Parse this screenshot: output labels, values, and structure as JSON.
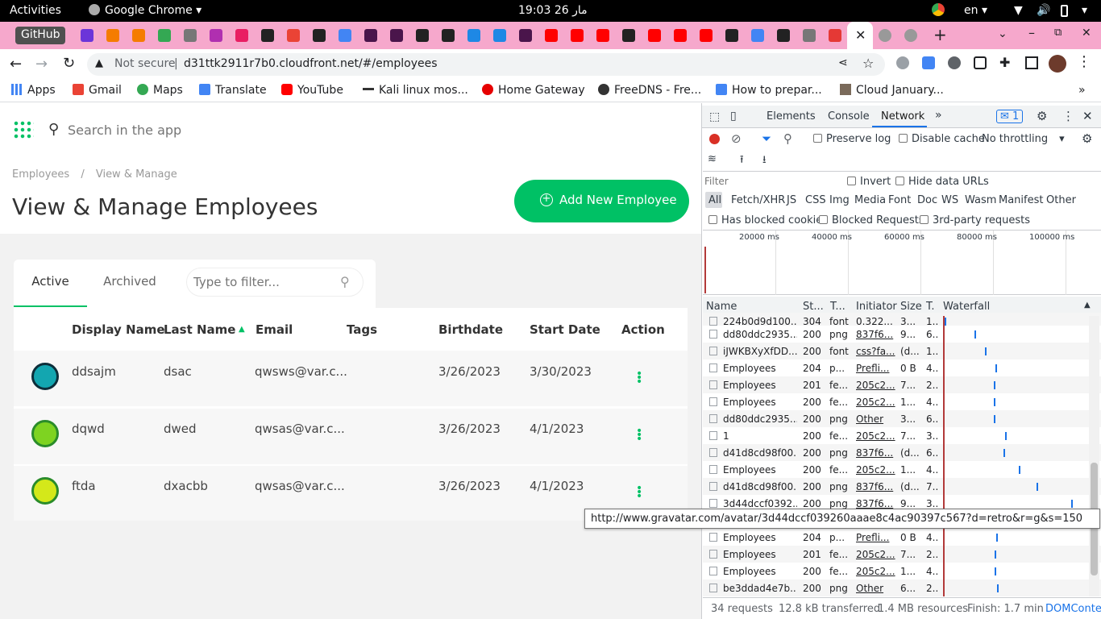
{
  "os": {
    "activities": "Activities",
    "app": "Google Chrome",
    "clock": "مار 26  19:03",
    "lang": "en"
  },
  "tabs": {
    "github": "GitHub"
  },
  "toolbar": {
    "not_secure": "Not secure",
    "url": "d31ttk2911r7b0.cloudfront.net/#/employees"
  },
  "bookmarks": [
    {
      "label": "Apps"
    },
    {
      "label": "Gmail"
    },
    {
      "label": "Maps"
    },
    {
      "label": "Translate"
    },
    {
      "label": "YouTube"
    },
    {
      "label": "Kali linux mos..."
    },
    {
      "label": "Home Gateway"
    },
    {
      "label": "FreeDNS - Fre..."
    },
    {
      "label": "How to prepar..."
    },
    {
      "label": "Cloud January..."
    }
  ],
  "app": {
    "search_placeholder": "Search in the app",
    "breadcrumb": {
      "root": "Employees",
      "sep": "/",
      "current": "View & Manage"
    },
    "title": "View & Manage Employees",
    "add_button": "Add New Employee",
    "tabs": {
      "active": "Active",
      "archived": "Archived"
    },
    "filter_placeholder": "Type to filter...",
    "columns": {
      "display_name": "Display Name",
      "last_name": "Last Name",
      "email": "Email",
      "tags": "Tags",
      "birthdate": "Birthdate",
      "start_date": "Start Date",
      "action": "Action"
    },
    "rows": [
      {
        "display_name": "ddsajm",
        "last_name": "dsac",
        "email": "qwsws@var.c...",
        "tags": "",
        "birthdate": "3/26/2023",
        "start_date": "3/30/2023"
      },
      {
        "display_name": "dqwd",
        "last_name": "dwed",
        "email": "qwsas@var.c...",
        "tags": "",
        "birthdate": "3/26/2023",
        "start_date": "4/1/2023"
      },
      {
        "display_name": "ftda",
        "last_name": "dxacbb",
        "email": "qwsas@var.c...",
        "tags": "",
        "birthdate": "3/26/2023",
        "start_date": "4/1/2023"
      }
    ]
  },
  "devtools": {
    "tabs": {
      "elements": "Elements",
      "console": "Console",
      "network": "Network",
      "issues": "1"
    },
    "preserve_log": "Preserve log",
    "disable_cache": "Disable cache",
    "throttling": "No throttling",
    "filter_placeholder": "Filter",
    "invert": "Invert",
    "hide_data_urls": "Hide data URLs",
    "types": [
      "All",
      "Fetch/XHR",
      "JS",
      "CSS",
      "Img",
      "Media",
      "Font",
      "Doc",
      "WS",
      "Wasm",
      "Manifest",
      "Other"
    ],
    "has_blocked_cookies": "Has blocked cookies",
    "blocked_requests": "Blocked Requests",
    "third_party": "3rd-party requests",
    "timeline_ticks": [
      "20000 ms",
      "40000 ms",
      "60000 ms",
      "80000 ms",
      "100000 ms"
    ],
    "columns": {
      "name": "Name",
      "status": "St...",
      "type": "T...",
      "initiator": "Initiator",
      "size": "Size",
      "time": "T.",
      "waterfall": "Waterfall"
    },
    "requests": [
      {
        "name": "224b0d9d100...",
        "status": "304",
        "type": "font",
        "initiator": "0.322...",
        "size": "3...",
        "time": "1..."
      },
      {
        "name": "dd80ddc2935...",
        "status": "200",
        "type": "png",
        "initiator": "837f6...",
        "size": "9...",
        "time": "6..."
      },
      {
        "name": "iJWKBXyXfDD...",
        "status": "200",
        "type": "font",
        "initiator": "css?fa...",
        "size": "(d...",
        "time": "1..."
      },
      {
        "name": "Employees",
        "status": "204",
        "type": "p...",
        "initiator": "Prefli...",
        "size": "0 B",
        "time": "4..."
      },
      {
        "name": "Employees",
        "status": "201",
        "type": "fe...",
        "initiator": "205c2...",
        "size": "7...",
        "time": "2..."
      },
      {
        "name": "Employees",
        "status": "200",
        "type": "fe...",
        "initiator": "205c2...",
        "size": "1...",
        "time": "4..."
      },
      {
        "name": "dd80ddc2935...",
        "status": "200",
        "type": "png",
        "initiator": "Other",
        "size": "3...",
        "time": "6..."
      },
      {
        "name": "1",
        "status": "200",
        "type": "fe...",
        "initiator": "205c2...",
        "size": "7...",
        "time": "3..."
      },
      {
        "name": "d41d8cd98f00...",
        "status": "200",
        "type": "png",
        "initiator": "837f6...",
        "size": "(d...",
        "time": "6..."
      },
      {
        "name": "Employees",
        "status": "200",
        "type": "fe...",
        "initiator": "205c2...",
        "size": "1...",
        "time": "4..."
      },
      {
        "name": "d41d8cd98f00...",
        "status": "200",
        "type": "png",
        "initiator": "837f6...",
        "size": "(d...",
        "time": "7..."
      },
      {
        "name": "3d44dccf0392...",
        "status": "200",
        "type": "png",
        "initiator": "837f6...",
        "size": "9...",
        "time": "3..."
      },
      {
        "name": "",
        "status": "",
        "type": "",
        "initiator": "",
        "size": "",
        "time": ""
      },
      {
        "name": "Employees",
        "status": "204",
        "type": "p...",
        "initiator": "Prefli...",
        "size": "0 B",
        "time": "4..."
      },
      {
        "name": "Employees",
        "status": "201",
        "type": "fe...",
        "initiator": "205c2...",
        "size": "7...",
        "time": "2..."
      },
      {
        "name": "Employees",
        "status": "200",
        "type": "fe...",
        "initiator": "205c2...",
        "size": "1...",
        "time": "4..."
      },
      {
        "name": "be3ddad4e7b...",
        "status": "200",
        "type": "png",
        "initiator": "Other",
        "size": "6...",
        "time": "2..."
      }
    ],
    "tooltip": "http://www.gravatar.com/avatar/3d44dccf039260aaae8c4ac90397c567?d=retro&r=g&s=150",
    "status": {
      "requests": "34 requests",
      "transferred": "12.8 kB transferred",
      "resources": "1.4 MB resources",
      "finish": "Finish: 1.7 min",
      "dom": "DOMConter"
    }
  }
}
